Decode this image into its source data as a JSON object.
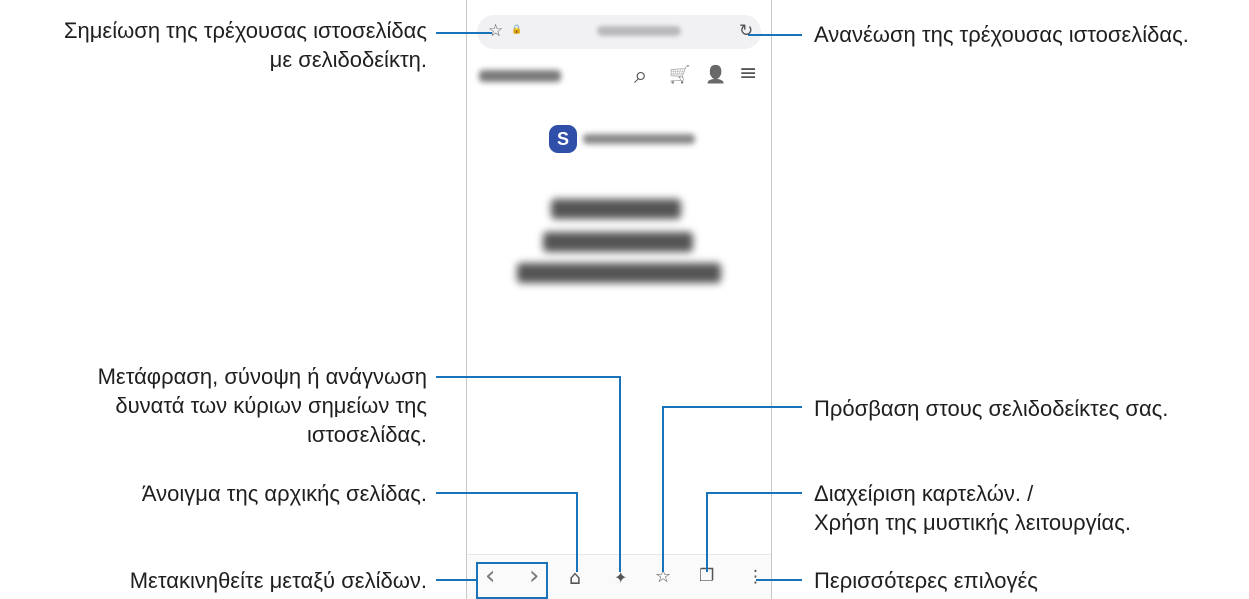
{
  "callouts": {
    "bookmark": "Σημείωση της τρέχουσας ιστοσελίδας\nμε σελιδοδείκτη.",
    "refresh": "Ανανέωση της τρέχουσας ιστοσελίδας.",
    "translate": "Μετάφραση, σύνοψη ή ανάγνωση\nδυνατά των κύριων σημείων της\nιστοσελίδας.",
    "bookmarks_access": "Πρόσβαση στους σελιδοδείκτες σας.",
    "home": "Άνοιγμα της αρχικής σελίδας.",
    "tabs": "Διαχείριση καρτελών. /\nΧρήση της μυστικής λειτουργίας.",
    "navigate": "Μετακινηθείτε μεταξύ σελίδων.",
    "more": "Περισσότερες επιλογές"
  },
  "icons": {
    "star": "☆",
    "lock": "🔒",
    "refresh": "↻",
    "search": "⌕",
    "cart": "🛒",
    "user": "👤",
    "menu": "≡",
    "smart_switch_letter": "S",
    "back": "‹",
    "forward": "›",
    "home": "⌂",
    "ai": "✦",
    "bookmarks": "☆",
    "tabs": "❐",
    "more": "⋮"
  },
  "colors": {
    "accent": "#1a73b8",
    "smart_switch": "#2f4fa8"
  }
}
